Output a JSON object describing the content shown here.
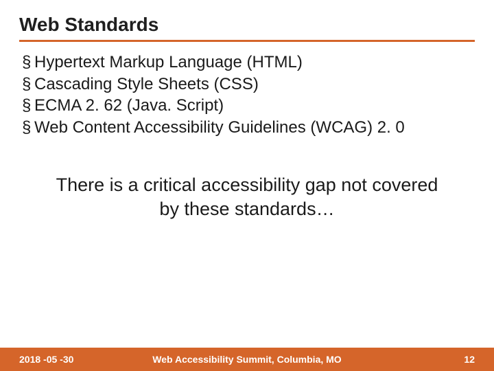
{
  "title": "Web Standards",
  "bullets": [
    "Hypertext Markup Language (HTML)",
    "Cascading Style Sheets (CSS)",
    "ECMA 2. 62 (Java. Script)",
    "Web Content Accessibility Guidelines (WCAG) 2. 0"
  ],
  "gap_text": "There is a critical accessibility gap not covered by these standards…",
  "footer": {
    "date": "2018 -05 -30",
    "event": "Web Accessibility Summit, Columbia, MO",
    "page": "12"
  }
}
